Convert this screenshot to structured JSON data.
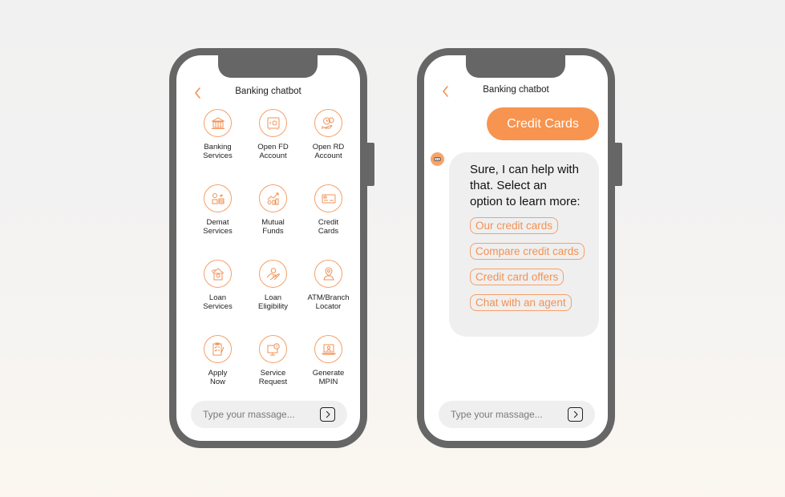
{
  "accent_color": "#F7944F",
  "frame_color": "#666666",
  "left_phone": {
    "header": {
      "title": "Banking chatbot",
      "back_icon": "chevron-left-icon"
    },
    "menu": [
      {
        "label": "Banking\nServices",
        "icon": "bank-building-icon"
      },
      {
        "label": "Open FD\nAccount",
        "icon": "safe-vault-icon"
      },
      {
        "label": "Open RD\nAccount",
        "icon": "coins-clock-hand-icon"
      },
      {
        "label": "Demat\nServices",
        "icon": "money-stack-growth-icon"
      },
      {
        "label": "Mutual\nFunds",
        "icon": "chart-coins-icon"
      },
      {
        "label": "Credit\nCards",
        "icon": "credit-card-icon"
      },
      {
        "label": "Loan\nServices",
        "icon": "loan-house-gear-icon"
      },
      {
        "label": "Loan\nEligibility",
        "icon": "hand-coin-icon"
      },
      {
        "label": "ATM/Branch\nLocator",
        "icon": "location-person-icon"
      },
      {
        "label": "Apply\nNow",
        "icon": "clipboard-checklist-icon"
      },
      {
        "label": "Service\nRequest",
        "icon": "monitor-alert-icon"
      },
      {
        "label": "Generate\nMPIN",
        "icon": "laptop-user-icon"
      }
    ],
    "input": {
      "placeholder": "Type your massage...",
      "value": ""
    },
    "send_icon": "chevron-right-icon"
  },
  "right_phone": {
    "header": {
      "title": "Banking chatbot",
      "back_icon": "chevron-left-icon"
    },
    "messages": [
      {
        "from": "user",
        "text": "Credit Cards"
      },
      {
        "from": "bot",
        "avatar_icon": "robot-icon",
        "text": "Sure, I can help with that. Select an option to learn more:",
        "options": [
          "Our credit cards",
          "Compare credit cards",
          "Credit card offers",
          "Chat with an agent"
        ]
      }
    ],
    "input": {
      "placeholder": "Type your massage...",
      "value": ""
    },
    "send_icon": "chevron-right-icon"
  }
}
